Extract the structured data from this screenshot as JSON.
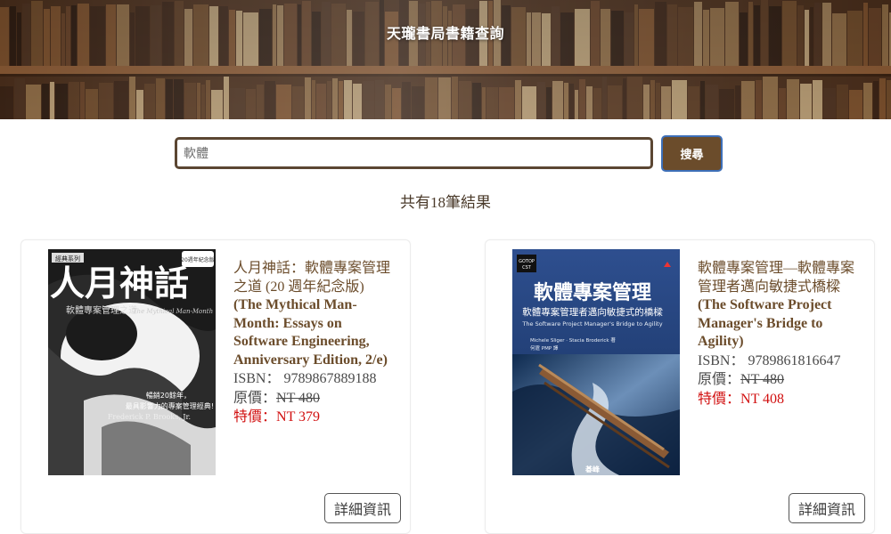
{
  "banner": {
    "title": "天瓏書局書籍查詢"
  },
  "search": {
    "value": "軟體",
    "button_label": "搜尋"
  },
  "results": {
    "count_text": "共有18筆結果"
  },
  "books": [
    {
      "title_zh": "人月神話：軟體專案管理之道 (20 週年紀念版)",
      "title_en": "(The Mythical Man-Month: Essays on Software Engineering, Anniversary Edition, 2/e)",
      "isbn_label": "ISBN：",
      "isbn": "9789867889188",
      "orig_label": "原價：",
      "orig_price": "NT 480",
      "sale_label": "特價：",
      "sale_price": "NT 379",
      "detail_label": "詳細資訊",
      "cover": {
        "tag": "經典系列",
        "title_zh": "人月神話",
        "title_en": "The Mythical Man-Month",
        "subtitle": "軟體專案管理之道",
        "badge": "20週年紀念版",
        "blurb1": "暢銷20餘年，",
        "blurb2": "最具影響力的專案管理經典!",
        "author": "Frederick P. Brooks, Jr."
      }
    },
    {
      "title_zh": "軟體專案管理—軟體專案管理者邁向敏捷式橋樑",
      "title_en": "(The Software Project Manager's Bridge to Agility)",
      "isbn_label": "ISBN：",
      "isbn": "9789861816647",
      "orig_label": "原價：",
      "orig_price": "NT 480",
      "sale_label": "特價：",
      "sale_price": "NT 408",
      "detail_label": "詳細資訊",
      "cover": {
        "title_zh": "軟體專案管理",
        "subtitle": "軟體專案管理者邁向敏捷式的橋樑",
        "title_en": "The Software Project Manager's Bridge to Agility",
        "authors": "Michele Sliger · Stacia Broderick 著",
        "translator": "何霆 PMP 譯",
        "publisher": "碁峰"
      }
    }
  ],
  "colors": {
    "brand_brown": "#6b4c2b",
    "sale_red": "#d10f0f",
    "button_border_blue": "#3d6fb8"
  },
  "icons": [
    "bookshelf-banner-image",
    "book-cover-mythical-man-month",
    "book-cover-software-project-management"
  ]
}
